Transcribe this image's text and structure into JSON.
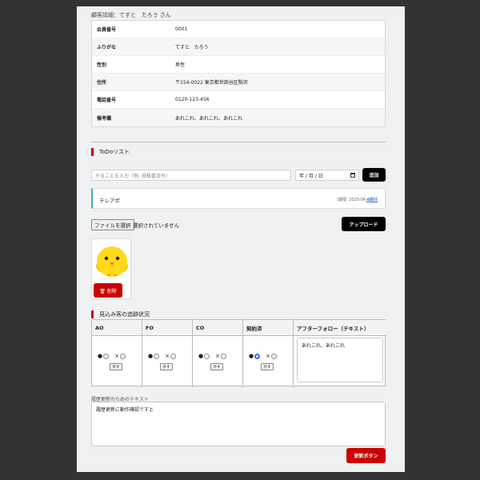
{
  "customer": {
    "heading": "顧客詳細：てすと　たろう さん",
    "rows": [
      {
        "label": "会員番号",
        "value": "0001"
      },
      {
        "label": "ふりがな",
        "value": "てすと　たろう"
      },
      {
        "label": "性別",
        "value": "男性"
      },
      {
        "label": "住所",
        "value": "〒154-0022 東京都世田谷区駒沢"
      },
      {
        "label": "電話番号",
        "value": "0120-123-456"
      },
      {
        "label": "備考欄",
        "value": "あれこれ、あれこれ、あれこれ"
      }
    ]
  },
  "todo": {
    "title": "ToDoリスト",
    "input_placeholder": "やることを入力（例: 見積書送付）",
    "date_placeholder": "年 / 月 / 日",
    "add_label": "追加",
    "items": [
      {
        "text": "テレアポ",
        "deadline": "（期限: 2025-06-20）",
        "delete_label": "✕削除"
      }
    ]
  },
  "upload": {
    "file_button": "ファイルを選択",
    "file_status": "選択されていません",
    "upload_label": "アップロード",
    "delete_label": "🗑 削除"
  },
  "tracking": {
    "title": "見込み客の追跡状況",
    "columns": [
      "AO",
      "FO",
      "CO",
      "契約済",
      "アフターフォロー（テキスト）"
    ],
    "radios": [
      {
        "selected": "●"
      },
      {
        "selected": "●"
      },
      {
        "selected": "●"
      },
      {
        "selected": "●"
      }
    ],
    "mark": "×",
    "clear_label": "外す",
    "followup_text": "あれこれ、あれこれ"
  },
  "history": {
    "label": "履歴更新のためのテキスト",
    "text": "履歴更新に動作確認ですと",
    "update_label": "更新ボタン"
  },
  "colors": {
    "accent_red": "#cc0000",
    "todo_border": "#3ab0c6",
    "radio_blue": "#2b6cf6"
  }
}
